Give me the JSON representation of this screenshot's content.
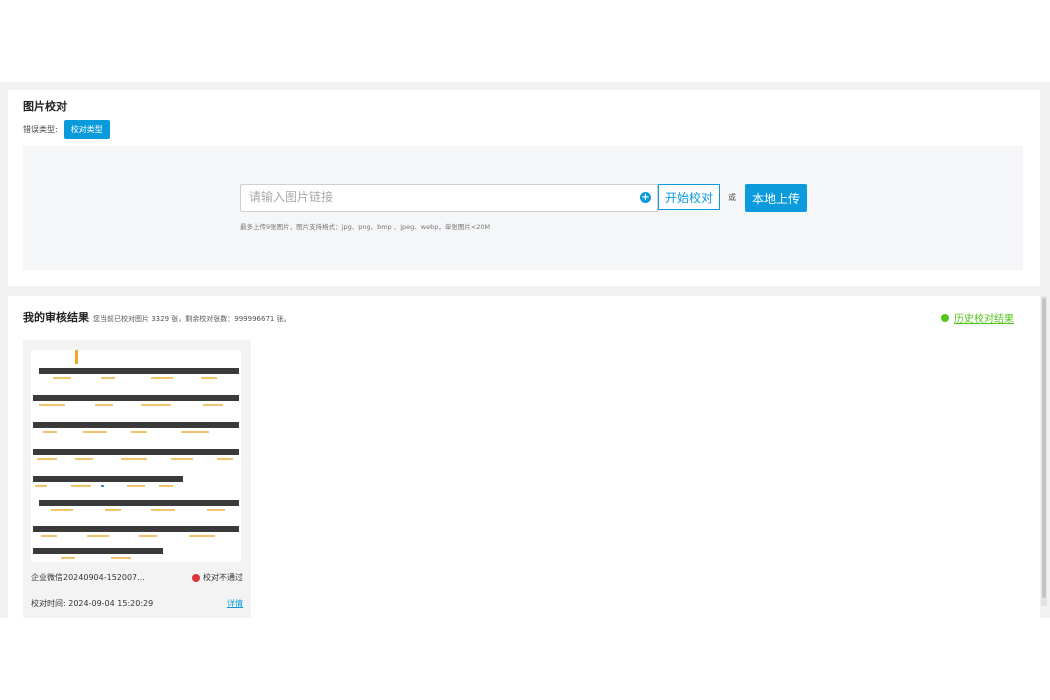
{
  "proofread_panel": {
    "title": "图片校对",
    "error_type_label": "错误类型:",
    "error_type_button": "校对类型",
    "url_input_placeholder": "请输入图片链接",
    "url_input_value": "",
    "add_icon": "plus-circle-icon",
    "start_button": "开始校对",
    "or_text": "或",
    "local_upload_button": "本地上传",
    "upload_hint": "最多上传9张图片，图片支持格式：jpg、png、bmp 、jpeg、webp，单张图片<20M"
  },
  "results_panel": {
    "title": "我的审核结果",
    "stats": "您当前已校对图片 3329 张，剩余校对张数：999996671 张。",
    "history_link": "历史校对结果",
    "cards": [
      {
        "filename": "企业微信20240904-152007...",
        "status": "校对不通过",
        "time_label": "校对时间:",
        "time": "2024-09-04 15:20:29",
        "detail_link": "详情"
      }
    ]
  },
  "colors": {
    "accent": "#0b9bdc",
    "success": "#52c41a",
    "error": "#d9363e",
    "highlight": "#f0c36d"
  }
}
